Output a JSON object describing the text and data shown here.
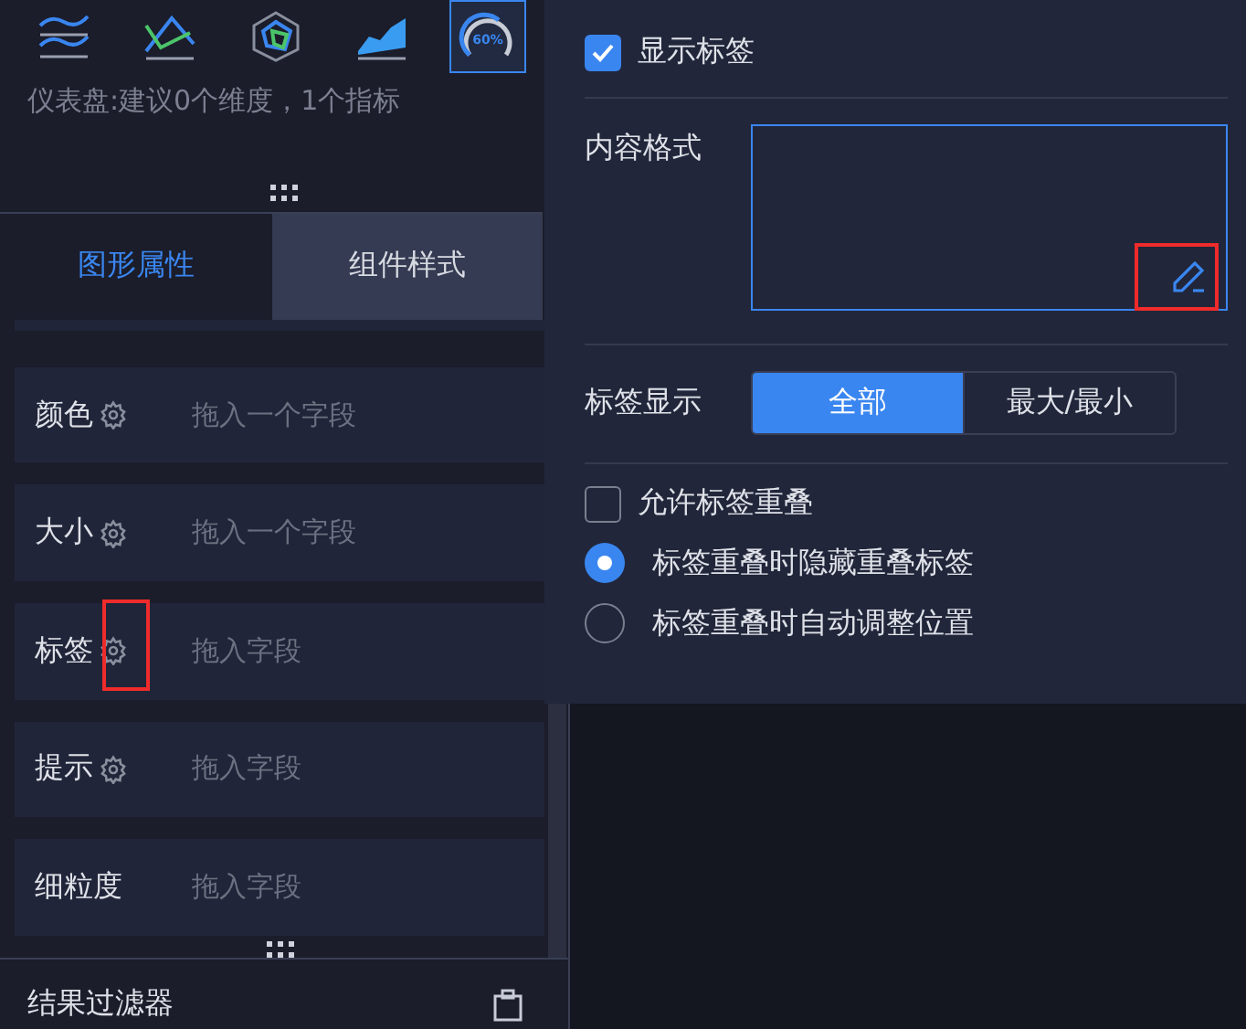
{
  "chart_types": [
    {
      "kind": "waves",
      "selected": false
    },
    {
      "kind": "polyline",
      "selected": false
    },
    {
      "kind": "radar",
      "selected": false
    },
    {
      "kind": "area",
      "selected": false
    },
    {
      "kind": "gauge",
      "label": "60%",
      "selected": true
    }
  ],
  "chart_hint": "仪表盘:建议0个维度，1个指标",
  "tabs": [
    {
      "label": "图形属性",
      "selected": true
    },
    {
      "label": "组件样式",
      "selected": false
    }
  ],
  "fields": [
    {
      "name": "颜色",
      "settings": true,
      "placeholder": "拖入一个字段",
      "highlighted": false
    },
    {
      "name": "大小",
      "settings": true,
      "placeholder": "拖入一个字段",
      "highlighted": false
    },
    {
      "name": "标签",
      "settings": true,
      "placeholder": "拖入字段",
      "highlighted": true
    },
    {
      "name": "提示",
      "settings": true,
      "placeholder": "拖入字段",
      "highlighted": false
    },
    {
      "name": "细粒度",
      "settings": false,
      "placeholder": "拖入字段",
      "highlighted": false
    }
  ],
  "result_filter": {
    "title": "结果过滤器"
  },
  "popup": {
    "show_labels": {
      "label": "显示标签",
      "checked": true
    },
    "content_format": {
      "label": "内容格式",
      "edit_highlighted": true
    },
    "label_display": {
      "label": "标签显示",
      "options": [
        {
          "label": "全部",
          "selected": true
        },
        {
          "label": "最大/最小",
          "selected": false
        }
      ]
    },
    "allow_overlap": {
      "label": "允许标签重叠",
      "checked": false
    },
    "overlap_modes": [
      {
        "label": "标签重叠时隐藏重叠标签",
        "selected": true
      },
      {
        "label": "标签重叠时自动调整位置",
        "selected": false
      }
    ]
  }
}
